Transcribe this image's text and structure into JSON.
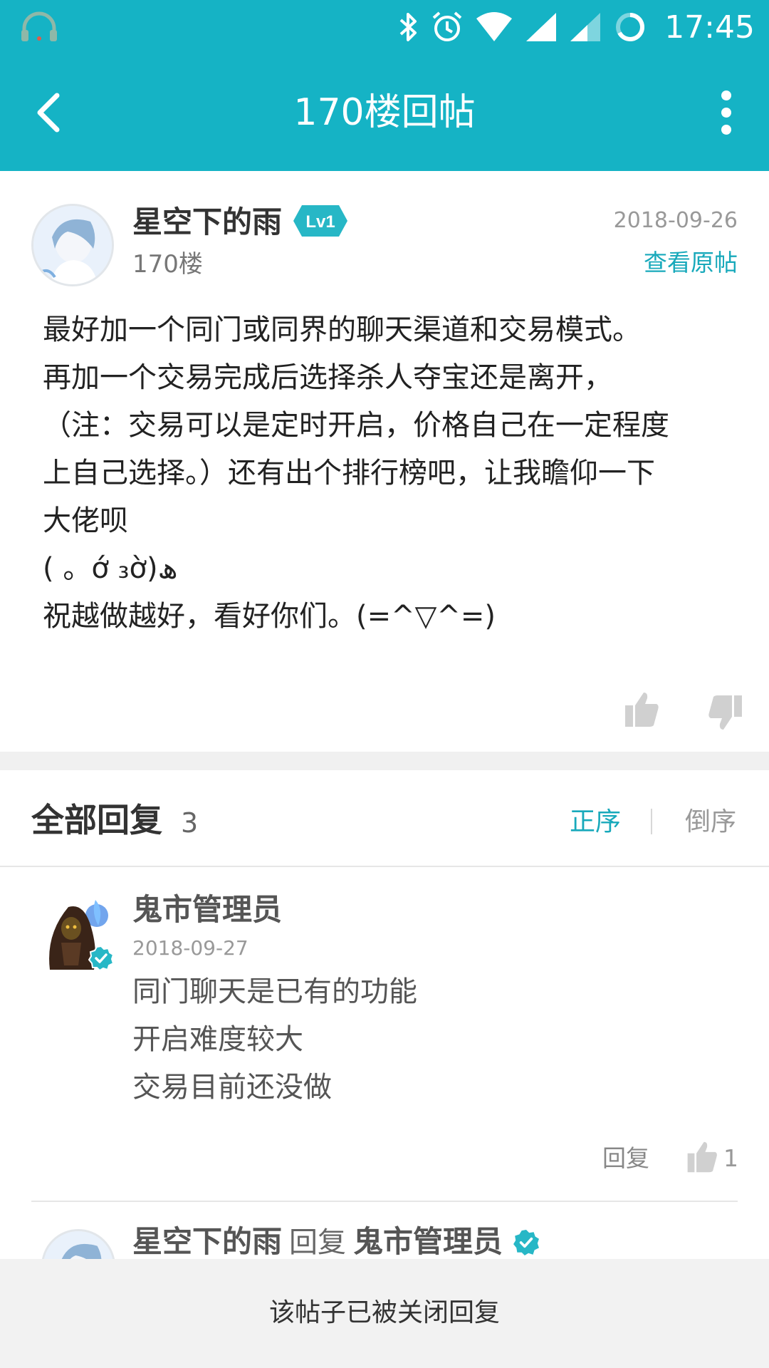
{
  "status_bar": {
    "time": "17:45",
    "icons": [
      "headset-icon",
      "bluetooth-icon",
      "alarm-icon",
      "wifi-icon",
      "signal-icon",
      "signal-icon",
      "battery-icon"
    ]
  },
  "app_bar": {
    "title": "170楼回帖",
    "back_icon": "chevron-left-icon",
    "more_icon": "more-vertical-icon"
  },
  "post": {
    "author": "星空下的雨",
    "level": "Lv1",
    "floor": "170楼",
    "date": "2018-09-26",
    "view_original": "查看原帖",
    "lines": [
      "最好加一个同门或同界的聊天渠道和交易模式。",
      "再加一个交易完成后选择杀人夺宝还是离开，",
      "（注：交易可以是定时开启，价格自己在一定程度",
      "上自己选择。）还有出个排行榜吧，让我瞻仰一下",
      "大佬呗",
      "( 。ớ ₃ờ)ھ",
      "祝越做越好，看好你们。(=^▽^=)"
    ]
  },
  "replies": {
    "title": "全部回复",
    "count": "3",
    "sort_asc": "正序",
    "sort_desc": "倒序"
  },
  "reply1": {
    "author": "鬼市管理员",
    "date": "2018-09-27",
    "lines": [
      "同门聊天是已有的功能",
      "开启难度较大",
      "交易目前还没做"
    ],
    "reply_label": "回复",
    "like_count": "1"
  },
  "reply2": {
    "author": "星空下的雨",
    "verb": "回复",
    "target": "鬼市管理员"
  },
  "footer": {
    "closed_text": "该帖子已被关闭回复"
  },
  "colors": {
    "accent": "#15b3c5",
    "link": "#18a9bb"
  }
}
